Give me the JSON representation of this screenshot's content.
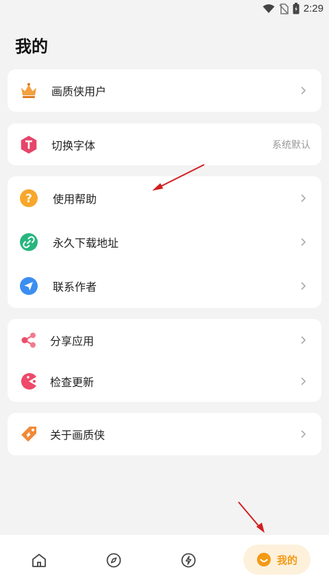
{
  "status_bar": {
    "time": "2:29"
  },
  "page": {
    "title": "我的"
  },
  "cards": {
    "vip": {
      "label": "画质侠用户"
    },
    "font": {
      "label": "切换字体",
      "value": "系统默认"
    },
    "help_group": [
      {
        "label": "使用帮助"
      },
      {
        "label": "永久下载地址"
      },
      {
        "label": "联系作者"
      }
    ],
    "app_group": [
      {
        "label": "分享应用"
      },
      {
        "label": "检查更新"
      }
    ],
    "about": {
      "label": "关于画质侠"
    }
  },
  "bottom_nav": {
    "items": [
      "home-icon",
      "compass-icon",
      "lightning-icon"
    ],
    "active": {
      "label": "我的",
      "icon": "smile-icon"
    }
  },
  "colors": {
    "accent": "#f39a16",
    "annotation": "#d21f1f",
    "background": "#f3f3f3"
  }
}
